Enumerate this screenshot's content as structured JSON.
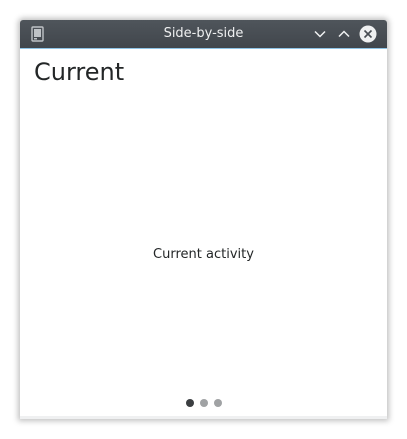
{
  "window": {
    "title": "Side-by-side",
    "icon": "app-window-icon",
    "buttons": {
      "minimize": "chevron-down-icon",
      "maximize": "chevron-up-icon",
      "close": "close-icon"
    }
  },
  "page": {
    "heading": "Current",
    "activity_text": "Current activity"
  },
  "pager": {
    "count": 3,
    "active_index": 0
  },
  "colors": {
    "titlebar": "#474c52",
    "titlebar_text": "#eff0f1",
    "accent": "#8fc4e6",
    "dot_active": "#3b3e41",
    "dot_inactive": "#a0a2a4"
  }
}
